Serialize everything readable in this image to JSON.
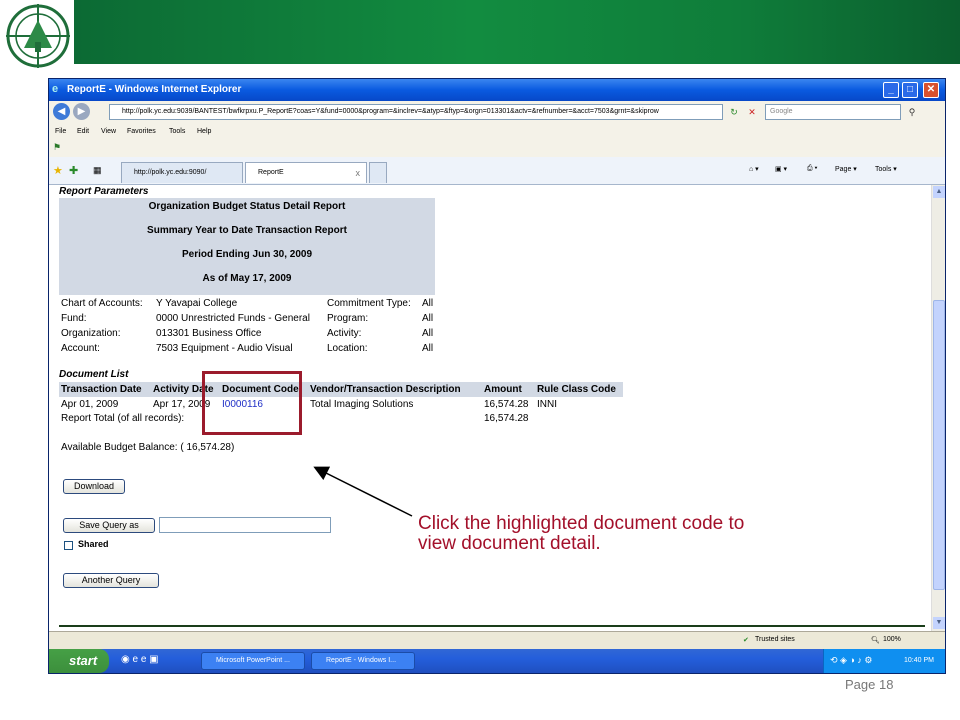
{
  "browser": {
    "title": "ReportE - Windows Internet Explorer",
    "address": "http://polk.yc.edu:9039/BANTEST/bwfkrpxu.P_ReportE?coas=Y&fund=0000&program=&inclrev=&atyp=&ftyp=&orgn=013301&actv=&refnumber=&acct=7503&grnt=&skiprow",
    "search_placeholder": "Google",
    "menu": [
      "File",
      "Edit",
      "View",
      "Favorites",
      "Tools",
      "Help"
    ],
    "tabs": [
      {
        "label": "http://polk.yc.edu:9090/"
      },
      {
        "label": "ReportE",
        "close": "x"
      }
    ],
    "commands": {
      "page": "Page",
      "tools": "Tools"
    }
  },
  "report": {
    "parameters_title": "Report Parameters",
    "header_lines": [
      "Organization Budget Status Detail Report",
      "Summary Year to Date Transaction Report",
      "Period Ending Jun 30, 2009",
      "As of May 17, 2009"
    ],
    "params_left": [
      {
        "label": "Chart of Accounts:",
        "value": "Y Yavapai College"
      },
      {
        "label": "Fund:",
        "value": "0000 Unrestricted Funds - General"
      },
      {
        "label": "Organization:",
        "value": "013301 Business Office"
      },
      {
        "label": "Account:",
        "value": "7503 Equipment - Audio Visual"
      }
    ],
    "params_right": [
      {
        "label": "Commitment Type:",
        "value": "All"
      },
      {
        "label": "Program:",
        "value": "All"
      },
      {
        "label": "Activity:",
        "value": "All"
      },
      {
        "label": "Location:",
        "value": "All"
      }
    ],
    "document_list_title": "Document List",
    "columns": [
      "Transaction Date",
      "Activity Date",
      "Document Code",
      "Vendor/Transaction Description",
      "Amount",
      "Rule Class Code"
    ],
    "rows": [
      {
        "transaction_date": "Apr 01, 2009",
        "activity_date": "Apr 17, 2009",
        "document_code": "I0000116",
        "description": "Total Imaging Solutions",
        "amount": "16,574.28",
        "rule_class": "INNI"
      }
    ],
    "total_label": "Report Total (of all records):",
    "total_amount": "16,574.28",
    "available_balance": "Available Budget Balance: ( 16,574.28)",
    "download_button": "Download",
    "save_query_button": "Save Query as",
    "shared_label": "Shared",
    "another_query_button": "Another Query"
  },
  "status_bar": {
    "zone": "Trusted sites",
    "zoom": "100%"
  },
  "taskbar": {
    "start": "start",
    "tasks": [
      "Microsoft PowerPoint ...",
      "ReportE - Windows I..."
    ],
    "time": "10:40 PM"
  },
  "callout": "Click the highlighted document code to view document detail.",
  "page_number": "Page 18",
  "colors": {
    "banner_green": "#128c40",
    "callout_red": "#a3102a",
    "highlight": "#9b1b2c"
  }
}
